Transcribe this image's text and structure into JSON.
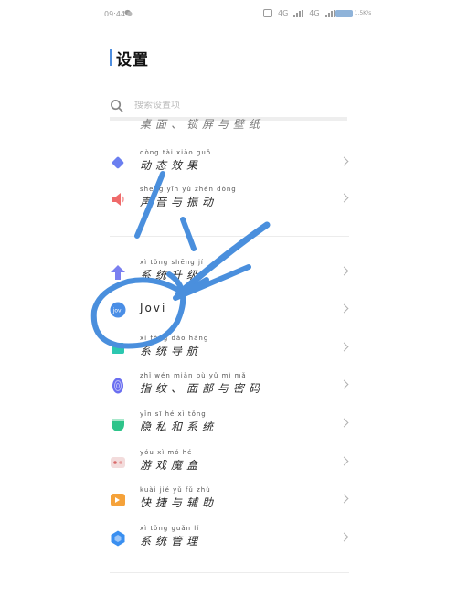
{
  "status_bar": {
    "time": "09:44",
    "network_right": "4G",
    "network_left": "4G",
    "speed": "1.5K/s"
  },
  "header": {
    "title": "设置"
  },
  "search": {
    "placeholder": "搜索设置项"
  },
  "items": [
    {
      "label": "桌面、锁屏与壁纸",
      "pinyin": "",
      "icon": "partial-row",
      "color": "#8a8a8a"
    },
    {
      "label": "动态效果",
      "pinyin": "dòng tài xiào guǒ",
      "icon": "diamond-icon",
      "color": "#6b7ff0"
    },
    {
      "label": "声音与振动",
      "pinyin": "shēng yīn yǔ zhèn dòng",
      "icon": "speaker-icon",
      "color": "#ef6a6a"
    },
    {
      "label": "系统升级",
      "pinyin": "xì tǒng shēng jí",
      "icon": "upgrade-arrow-icon",
      "color": "#7a7ff0"
    },
    {
      "label": "Jovi",
      "pinyin": "",
      "icon": "jovi-icon",
      "color": "#4a8ee6"
    },
    {
      "label": "系统导航",
      "pinyin": "xì tǒng dǎo háng",
      "icon": "navigation-icon",
      "color": "#2cc7b0"
    },
    {
      "label": "指纹、面部与密码",
      "pinyin": "zhǐ wén miàn bù yǔ mì mǎ",
      "icon": "fingerprint-icon",
      "color": "#6a6ef0"
    },
    {
      "label": "隐私和系统",
      "pinyin": "yǐn sī hé xì tǒng",
      "icon": "privacy-shield-icon",
      "color": "#2ec48a"
    },
    {
      "label": "游戏魔盒",
      "pinyin": "yóu xì mó hé",
      "icon": "game-box-icon",
      "color": "#e8a0a0"
    },
    {
      "label": "快捷与辅助",
      "pinyin": "kuài jié yǔ fǔ zhù",
      "icon": "shortcut-icon",
      "color": "#f5a23a"
    },
    {
      "label": "系统管理",
      "pinyin": "xì tǒng guǎn lǐ",
      "icon": "system-management-icon",
      "color": "#3a8ff0"
    }
  ],
  "colors": {
    "accent": "#4f8fe0",
    "annotation_stroke": "#4a8fdd"
  }
}
